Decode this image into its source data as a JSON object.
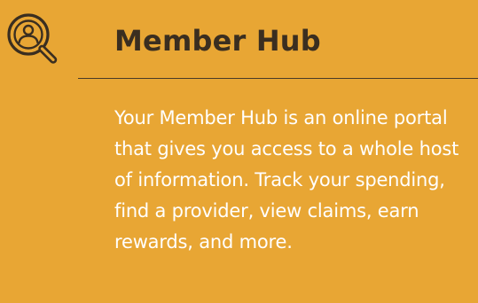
{
  "card": {
    "icon": "member-search-icon",
    "title": "Member Hub",
    "body": "Your Member Hub is an online portal that gives you access to a whole host of information. Track your spending, find a provider, view claims, earn rewards, and more.",
    "colors": {
      "background": "#E8A634",
      "title": "#3A2E20",
      "body": "#FFFFFF",
      "divider": "#4A3A26"
    }
  }
}
